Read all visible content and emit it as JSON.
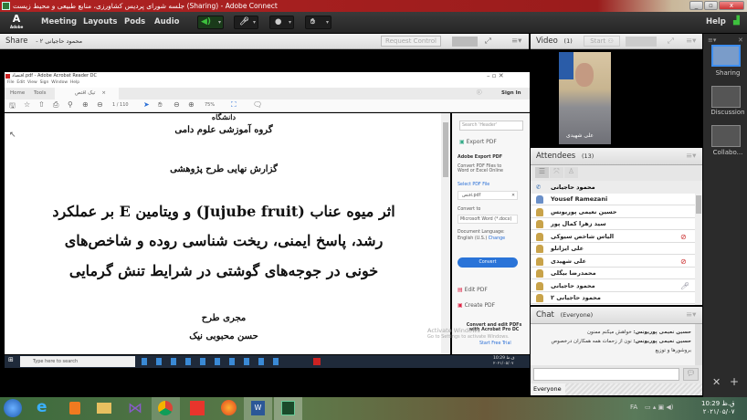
{
  "window": {
    "title": "جلسه شورای پردیس کشاورزی، منابع طبیعی و محیط زیست (Sharing) - Adobe Connect",
    "app": "Adobe Connect"
  },
  "menu": {
    "logo": "Adobe",
    "items": [
      "Meeting",
      "Layouts",
      "Pods",
      "Audio"
    ],
    "help": "Help",
    "speaker_color": "#3ec13e"
  },
  "share_pod": {
    "title": "Share",
    "presenter": "- محمود حاجیانی ۲",
    "request_control": "Request Control"
  },
  "acrobat": {
    "title": "اقتصاد.pdf - Adobe Acrobat Reader DC",
    "menu": [
      "File",
      "Edit",
      "View",
      "Sign",
      "Window",
      "Help"
    ],
    "tabs": [
      "Home",
      "Tools",
      "تیک اقتص"
    ],
    "page": "1",
    "page_total": "/ 110",
    "zoom": "75%",
    "sign_in": "Sign In",
    "document": {
      "line0": "دانشگاه",
      "department": "گروه آموزشی علوم دامی",
      "report": "گزارش نهایی طرح پژوهشی",
      "title_lines": [
        "اثر میوه عناب (Jujube fruit) و ویتامین E بر عملکرد",
        "رشد، پاسخ ایمنی، ریخت شناسی روده و شاخص‌های",
        "خونی در جوجه‌های گوشتی در شرایط تنش گرمایی"
      ],
      "executor_label": "مجری طرح",
      "executor": "حسن محبوبی نیک"
    },
    "right_pane": {
      "search": "Search 'Header'",
      "export_pdf": "Export PDF",
      "adobe_export": "Adobe Export PDF",
      "export_desc": "Convert PDF Files to Word or Excel Online",
      "select_file": "Select PDF File",
      "file": "اقتص.pdf",
      "convert_to": "Convert to",
      "format": "Microsoft Word (*.docx)",
      "doc_lang": "Document Language:",
      "lang": "English (U.S.)",
      "change": "Change",
      "convert": "Convert",
      "edit_pdf": "Edit PDF",
      "create_pdf": "Create PDF",
      "promo": "Convert and edit PDFs with Acrobat Pro DC",
      "trial": "Start Free Trial",
      "activate": "Activate Windows",
      "activate2": "Go to Settings to activate Windows."
    }
  },
  "inner_taskbar": {
    "search": "Type here to search",
    "time": "10:29 ق.ظ",
    "date": "۲۰۲۱/۰۵/۰۷"
  },
  "video_pod": {
    "title": "Video",
    "count": "(1)",
    "start": "Start",
    "name": "علی شهیدی"
  },
  "attendees": {
    "title": "Attendees",
    "count": "(13)",
    "host": "محمود حاجیانی",
    "list": [
      "Yousef Ramezani",
      "حسین نعیمی پوریونس",
      "سید زهرا کمال پور",
      "الیاس شاخص سیوکی",
      "علی ایزانلو",
      "علی شهیدی",
      "محمدرضا بیگلی",
      "محمود حاجیانی",
      "محمود حاجیانی ۲"
    ]
  },
  "chat": {
    "title": "Chat",
    "scope": "(Everyone)",
    "messages": [
      {
        "sender": "حسین نعیمی پوریونس:",
        "text": "خواهش میکنم ممنون"
      },
      {
        "sender": "حسین نعیمی پوریونس:",
        "text": "نون از زحمات همه همکاران درخصوص بروشورها و توزیع"
      }
    ],
    "input_placeholder": "",
    "tab": "Everyone"
  },
  "layouts": {
    "items": [
      "Sharing",
      "Discussion",
      "Collabo..."
    ]
  },
  "taskbar": {
    "lang": "FA",
    "time": "10:29 ق.ظ",
    "date": "۲۰۲۱/۰۵/۰۷"
  }
}
